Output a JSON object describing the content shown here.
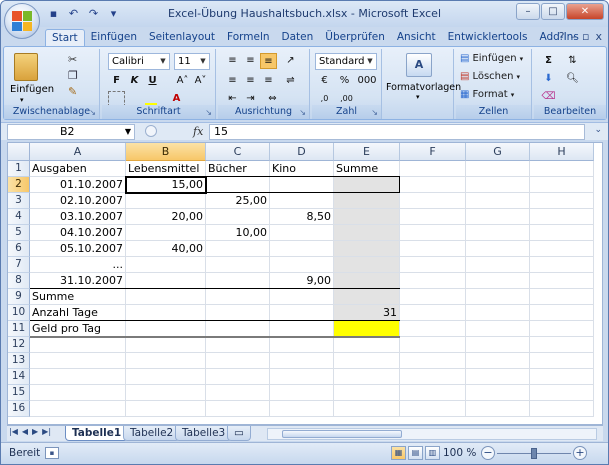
{
  "window": {
    "title": "Excel-Übung Haushaltsbuch.xlsx - Microsoft Excel"
  },
  "qat": {
    "icons": [
      "save-icon",
      "undo-icon",
      "redo-icon",
      "customize-icon"
    ]
  },
  "ribbon": {
    "tabs": [
      "Start",
      "Einfügen",
      "Seitenlayout",
      "Formeln",
      "Daten",
      "Überprüfen",
      "Ansicht",
      "Entwicklertools",
      "Add-Ins"
    ],
    "active_tab": "Start",
    "groups": {
      "clipboard": {
        "label": "Zwischenablage",
        "paste": "Einfügen"
      },
      "font": {
        "label": "Schriftart",
        "font_name": "Calibri",
        "font_size": "11",
        "bold": "F",
        "italic": "K",
        "underline": "U"
      },
      "alignment": {
        "label": "Ausrichtung"
      },
      "number": {
        "label": "Zahl",
        "format": "Standard",
        "percent": "%",
        "thousands": "000"
      },
      "styles": {
        "label": "Formatvorlagen"
      },
      "cells": {
        "label": "Zellen",
        "insert": "Einfügen",
        "delete": "Löschen",
        "format": "Format"
      },
      "editing": {
        "label": "Bearbeiten"
      }
    }
  },
  "formula_bar": {
    "name_box": "B2",
    "fx": "fx",
    "value": "15"
  },
  "grid": {
    "columns": [
      "A",
      "B",
      "C",
      "D",
      "E",
      "F",
      "G",
      "H"
    ],
    "rows": [
      "1",
      "2",
      "3",
      "4",
      "5",
      "6",
      "7",
      "8",
      "9",
      "10",
      "11",
      "12",
      "13",
      "14",
      "15",
      "16"
    ],
    "cells": {
      "A1": "Ausgaben",
      "B1": "Lebensmittel",
      "C1": "Bücher",
      "D1": "Kino",
      "E1": "Summe",
      "A2": "01.10.2007",
      "B2": "15,00",
      "A3": "02.10.2007",
      "C3": "25,00",
      "A4": "03.10.2007",
      "B4": "20,00",
      "D4": "8,50",
      "A5": "04.10.2007",
      "C5": "10,00",
      "A6": "05.10.2007",
      "B6": "40,00",
      "A7": "...",
      "A8": "31.10.2007",
      "D8": "9,00",
      "A9": "Summe",
      "A10": "Anzahl Tage",
      "E10": "31",
      "A11": "Geld pro Tag"
    }
  },
  "sheets": {
    "tabs": [
      "Tabelle1",
      "Tabelle2",
      "Tabelle3"
    ],
    "active": "Tabelle1"
  },
  "status": {
    "mode": "Bereit",
    "zoom": "100 %"
  },
  "colors": {
    "accent_selection": "#f7c769",
    "gray_fill": "#e3e3e3",
    "yellow_fill": "#ffff00"
  }
}
